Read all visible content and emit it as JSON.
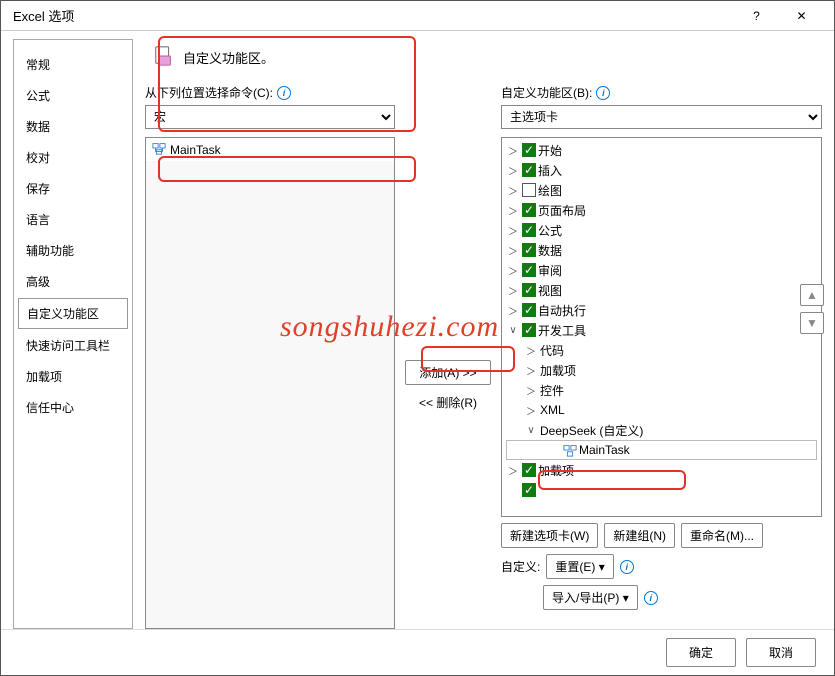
{
  "titlebar": {
    "title": "Excel 选项",
    "help": "?",
    "close": "✕"
  },
  "sidebar": {
    "items": [
      "常规",
      "公式",
      "数据",
      "校对",
      "保存",
      "语言",
      "辅助功能",
      "高级",
      "自定义功能区",
      "快速访问工具栏",
      "加载项",
      "信任中心"
    ],
    "active": 8
  },
  "head": {
    "text": "自定义功能区。"
  },
  "left": {
    "label": "从下列位置选择命令(C):",
    "select": "宏",
    "item": "MainTask"
  },
  "mid": {
    "add": "添加(A) >>",
    "remove": "<< 删除(R)"
  },
  "right": {
    "label": "自定义功能区(B):",
    "select": "主选项卡",
    "tree": [
      {
        "lvl": 0,
        "tw": ">",
        "cb": true,
        "label": "开始"
      },
      {
        "lvl": 0,
        "tw": ">",
        "cb": true,
        "label": "插入"
      },
      {
        "lvl": 0,
        "tw": ">",
        "cb": false,
        "label": "绘图"
      },
      {
        "lvl": 0,
        "tw": ">",
        "cb": true,
        "label": "页面布局"
      },
      {
        "lvl": 0,
        "tw": ">",
        "cb": true,
        "label": "公式"
      },
      {
        "lvl": 0,
        "tw": ">",
        "cb": true,
        "label": "数据"
      },
      {
        "lvl": 0,
        "tw": ">",
        "cb": true,
        "label": "审阅"
      },
      {
        "lvl": 0,
        "tw": ">",
        "cb": true,
        "label": "视图"
      },
      {
        "lvl": 0,
        "tw": ">",
        "cb": true,
        "label": "自动执行"
      },
      {
        "lvl": 0,
        "tw": "v",
        "cb": true,
        "label": "开发工具"
      },
      {
        "lvl": 1,
        "tw": ">",
        "label": "代码"
      },
      {
        "lvl": 1,
        "tw": ">",
        "label": "加载项"
      },
      {
        "lvl": 1,
        "tw": ">",
        "label": "控件"
      },
      {
        "lvl": 1,
        "tw": ">",
        "label": "XML"
      },
      {
        "lvl": 1,
        "tw": "v",
        "label": "DeepSeek (自定义)",
        "hl": true
      },
      {
        "lvl": 2,
        "icon": "macro",
        "label": "MainTask",
        "sel": true
      },
      {
        "lvl": 0,
        "tw": ">",
        "cb": true,
        "label": "加载项"
      },
      {
        "lvl": 0,
        "tw": "",
        "cb": true,
        "label": ""
      }
    ],
    "newTab": "新建选项卡(W)",
    "newGroup": "新建组(N)",
    "rename": "重命名(M)...",
    "customLabel": "自定义:",
    "reset": "重置(E)",
    "importExport": "导入/导出(P)"
  },
  "footer": {
    "ok": "确定",
    "cancel": "取消"
  },
  "watermark": "songshuhezi.com",
  "chart_data": null
}
